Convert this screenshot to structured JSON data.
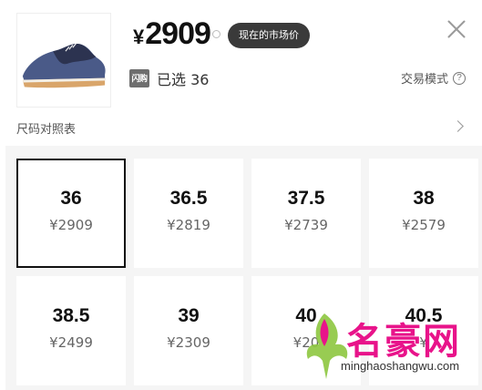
{
  "product": {
    "image_alt": "shoe"
  },
  "price": {
    "currency": "¥",
    "amount": "2909"
  },
  "tooltip": "现在的市场价",
  "selected": {
    "badge": "闪购",
    "text": "已选 36"
  },
  "trade_mode": "交易模式",
  "size_chart": "尺码对照表",
  "sizes": [
    {
      "size": "36",
      "price": "¥2909",
      "selected": true
    },
    {
      "size": "36.5",
      "price": "¥2819"
    },
    {
      "size": "37.5",
      "price": "¥2739"
    },
    {
      "size": "38",
      "price": "¥2579"
    },
    {
      "size": "38.5",
      "price": "¥2499"
    },
    {
      "size": "39",
      "price": "¥2309"
    },
    {
      "size": "40",
      "price": "¥20"
    },
    {
      "size": "40.5",
      "price": "¥"
    }
  ],
  "watermark": {
    "name": "名豪网",
    "url": "minghaoshangwu.com"
  },
  "colors": {
    "accent": "#111111",
    "tooltip_bg": "#3a3a3a",
    "watermark": "#e8138a"
  }
}
